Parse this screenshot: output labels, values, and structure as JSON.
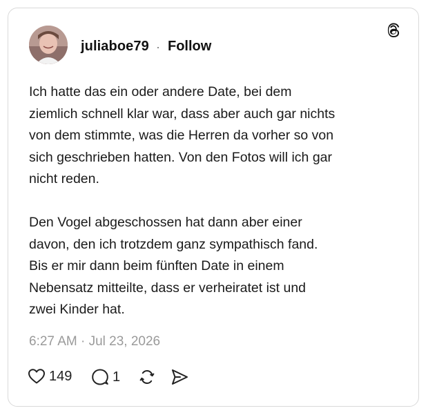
{
  "post": {
    "username": "juliaboe79",
    "separator": "·",
    "follow_label": "Follow",
    "body": "Ich hatte das ein oder andere Date, bei dem\nziemlich schnell klar war, dass aber auch gar nichts\nvon dem stimmte, was die Herren da vorher so von\nsich geschrieben hatten. Von den Fotos will ich gar\nnicht reden.\n\nDen Vogel abgeschossen hat dann aber einer\ndavon, den ich trotzdem ganz sympathisch fand.\nBis er mir dann beim fünften  Date in einem\nNebensatz mitteilte, dass er verheiratet ist und\nzwei Kinder hat.",
    "timestamp": "6:27 AM · Jul 23, 2026"
  },
  "actions": {
    "likes": "149",
    "replies": "1"
  },
  "icons": {
    "brand": "threads-icon",
    "like": "heart-icon",
    "reply": "reply-bubble-icon",
    "repost": "repost-icon",
    "share": "share-send-icon"
  },
  "colors": {
    "text": "#111111",
    "muted": "#9a9a9a",
    "border": "#d9d9d9"
  }
}
